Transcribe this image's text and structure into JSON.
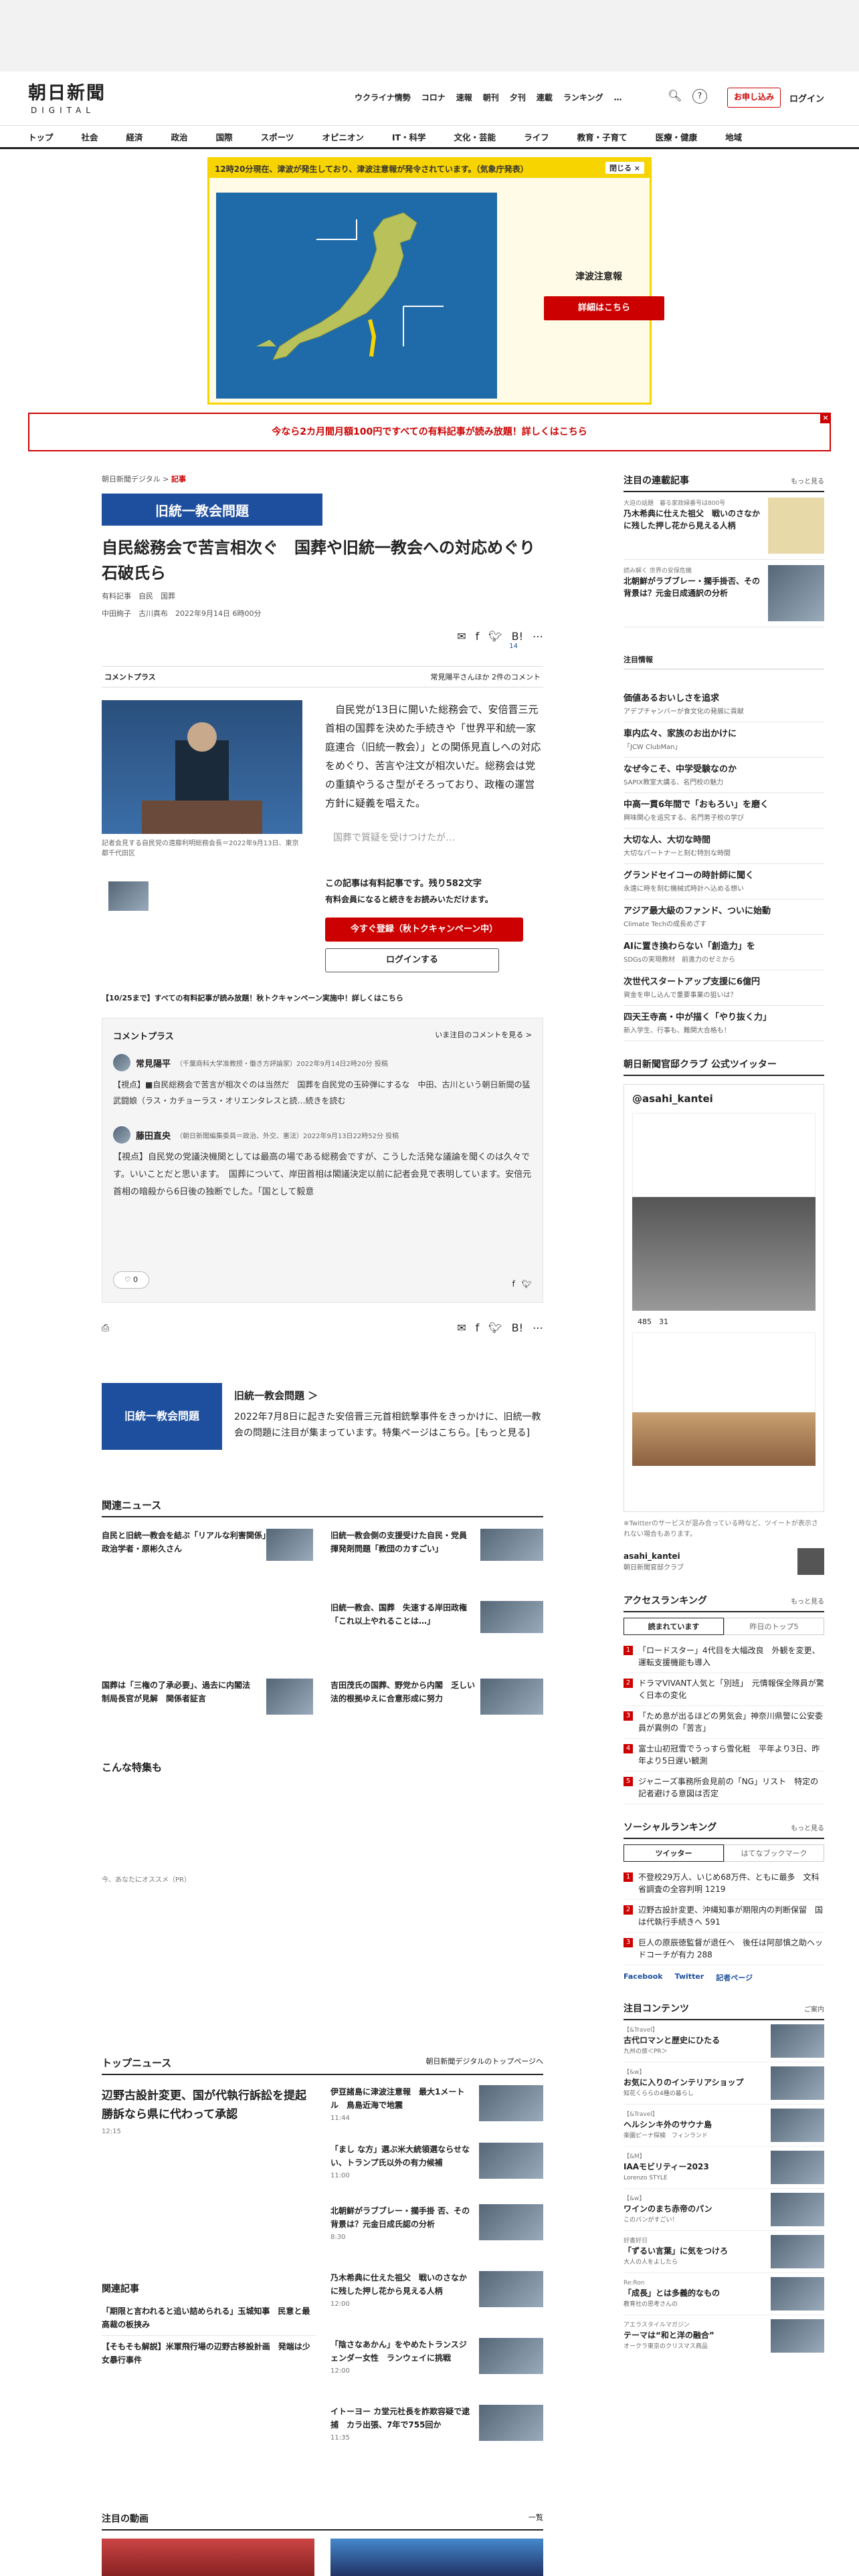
{
  "header": {
    "logo_ja": "朝日新聞",
    "logo_en": "DIGITAL",
    "nav": [
      "ウクライナ情勢",
      "コロナ",
      "速報",
      "朝刊",
      "夕刊",
      "連載",
      "ランキング",
      "…"
    ],
    "help": "?",
    "apply": "お申し込み",
    "login": "ログイン"
  },
  "categories": [
    "トップ",
    "社会",
    "経済",
    "政治",
    "国際",
    "スポーツ",
    "オピニオン",
    "IT・科学",
    "文化・芸能",
    "ライフ",
    "教育・子育て",
    "医療・健康",
    "地域"
  ],
  "tsunami": {
    "bar": "12時20分現在、津波が発生しており、津波注意報が発令されています。（気象庁発表）",
    "close": "閉じる ×",
    "label": "津波注意報",
    "button": "詳細はこちら"
  },
  "promo": {
    "text": "今なら2カ月間月額100円ですべての有料記事が読み放題！詳しくはこちら",
    "close": "×"
  },
  "article": {
    "breadcrumb_site": "朝日新聞デジタル",
    "breadcrumb_sep": ">",
    "breadcrumb_cat": "記事",
    "banner": "旧統一教会問題",
    "title": "自民総務会で苦言相次ぐ　国葬や旧統一教会への対応めぐり石破氏ら",
    "tags": "有料記事　自民　国葬",
    "authors": "中田絢子　古川真布　2022年9月14日 6時00分",
    "share_count": "14",
    "comment_plus": "コメントプラス",
    "comment_note": "常見陽平さんほか 2件のコメント",
    "photo_caption": "記者会見する自民党の遠藤利明総務会長＝2022年9月13日、東京都千代田区",
    "body": "　自民党が13日に開いた総務会で、安倍晋三元首相の国葬を決めた手続きや「世界平和統一家庭連合（旧統一教会）」との関係見直しへの対応をめぐり、苦言や注文が相次いだ。総務会は党の重鎮やうるさ型がそろっており、政権の運営方針に疑義を唱えた。",
    "body_cut": "国葬で質疑を受けつけたが…",
    "paywall": "この記事は有料記事です。残り582文字",
    "paywall2": "有料会員になると続きをお読みいただけます。",
    "subscribe": "今すぐ登録（秋トクキャンペーン中）",
    "login": "ログインする",
    "campaign": "【10/25まで】すべての有料記事が読み放題！秋トクキャンペーン実施中！詳しくはこちら"
  },
  "comments": {
    "title": "コメントプラス",
    "link": "いま注目のコメントを見る >",
    "items": [
      {
        "name": "常見陽平",
        "role": "（千葉商科大学准教授・働き方評論家）2022年9月14日2時20分 投稿",
        "text": "【視点】■自民総務会で苦言が相次ぐのは当然だ　国葬を自民党の玉砕弾にするな　中田、古川という朝日新聞の猛武闘娘（ラス・カチョーラス・オリエンタレスと読…続きを読む"
      },
      {
        "name": "藤田直央",
        "role": "（朝日新聞編集委員＝政治、外交、憲法）2022年9月13日22時52分 投稿",
        "text": "【視点】自民党の党議決機関としては最高の場である総務会ですが、こうした活発な議論を聞くのは久々です。いいことだと思います。　国葬について、岸田首相は閣議決定以前に記者会見で表明しています。安倍元首相の暗殺から6日後の独断でした。「国として毅意"
      }
    ],
    "likes": "0"
  },
  "feature": {
    "title": "旧統一教会問題 ＞",
    "text": "2022年7月8日に起きた安倍晋三元首相銃撃事件をきっかけに、旧統一教会の問題に注目が集まっています。特集ページはこちら。[もっと見る]"
  },
  "related": {
    "title": "関連ニュース",
    "items": [
      "自民と旧統一教会を結ぶ「リアルな利害関係」　政治学者・原彬久さん",
      "旧統一教会側の支援受けた自民・党員　揮発剤問題「教団のカすごい」",
      "旧統一教会、国葬　失速する岸田政権　「これ以上やれることは…」",
      "国葬は「三権の了承必要」、過去に内閣法制局長官が見解　関係者証言",
      "吉田茂氏の国葬、野党から内閣　乏しい法的根拠ゆえに合意形成に努力"
    ]
  },
  "specials_title": "こんな特集も",
  "recommend_title": "今、あなたにオススメ（PR）",
  "topnews": {
    "title": "トップニュース",
    "link": "朝日新聞デジタルのトップページへ",
    "main": "辺野古設計変更、国が代執行訴訟を提起　勝訴なら県に代わって承認",
    "main_time": "12:15",
    "items": [
      {
        "t": "伊豆諸島に津波注意報　最大1メートル　鳥島近海で地震",
        "time": "11:44"
      },
      {
        "t": "「まし な方」選ぶ米大統領選ならせない、トランプ氏以外の有力候補",
        "time": "11:00"
      },
      {
        "t": "北朝鮮がラブブレー・擱手掛 否、その背景は？元金日成氏認の分析",
        "time": "8:30"
      },
      {
        "t": "乃木希典に仕えた祖父　戦いのさなかに残した押し花から見える人柄",
        "time": "12:00"
      },
      {
        "t": "「陰さなあかん」をやめたトランスジェンダー女性　ランウェイに挑戦",
        "time": "12:00"
      },
      {
        "t": "イトーヨー カ堂元社長を詐欺容疑で逮捕　カラ出張、7年で755回か",
        "time": "11:35"
      }
    ],
    "related_title": "関連記事",
    "related": [
      "「期限と言われると追い詰められる」玉城知事　民意と最高裁の板挟み",
      "【そもそも解説】米軍飛行場の辺野古移設計画　発端は少女暴行事件"
    ]
  },
  "video_title": "注目の動画",
  "video_more": "一覧",
  "sidebar": {
    "series_title": "注目の連載記事",
    "more": "もっと見る",
    "series": [
      {
        "t": "乃木希典に仕えた祖父　戦いのさなかに残した押し花から見える人柄",
        "s": "大迫の話題　暮る家政婦番号は800号"
      },
      {
        "t": "北朝鮮がラブブレー・擱手掛否、その背景は？元金日成通訳の分析",
        "s": "読み解く 世界の安保危機"
      }
    ],
    "pr_title": "注目情報",
    "pr": [
      {
        "t": "価値あるおいしさを追求",
        "s": "アデプチャンバーが食文化の発展に貢献"
      },
      {
        "t": "車内広々、家族のお出かけに",
        "s": "「JCW ClubMan」"
      },
      {
        "t": "なぜ今こそ、中学受験なのか",
        "s": "SAPIX教室大講る、名門校の魅力"
      },
      {
        "t": "中高一貫6年間で「おもろい」を磨く",
        "s": "興味関心を追究する、名門男子校の学び"
      },
      {
        "t": "大切な人、大切な時間",
        "s": "大切なパートナーと刻む特別な時間"
      },
      {
        "t": "グランドセイコーの時計師に聞く",
        "s": "永遠に時を刻む機械式時計へ込める想い"
      },
      {
        "t": "アジア最大級のファンド、ついに始動",
        "s": "Climate Techの成長めざす"
      },
      {
        "t": "AIに置き換わらない「創造力」を",
        "s": "SDGsの実現教材　前進力のゼミから"
      },
      {
        "t": "次世代スタートアップ支援に6億円",
        "s": "資金を申し込んで重要事業の狙いは？"
      },
      {
        "t": "四天王寺高・中が描く「やり抜く力」",
        "s": "新入学生、行事も、難関大合格も！"
      }
    ],
    "twitter_title": "朝日新聞官邸クラブ 公式ツイッター",
    "twitter_handle": "@asahi_kantei",
    "tw_counts": "485　31",
    "tw_note": "※Twitterのサービスが混み合っている時など、ツイートが表示されない場合もあります。",
    "tw_account": "asahi_kantei",
    "tw_account_sub": "朝日新聞官邸クラブ",
    "ranking_title": "アクセスランキング",
    "ranking_tabs": [
      "読まれています",
      "昨日のトップ5"
    ],
    "ranking": [
      "「ロードスター」4代目を大幅改良　外観を変更、運転支援機能も導入",
      "ドラマVIVANT人気と「別班」　元情報保全隊員が驚く日本の変化",
      "「ため息が出るほどの男気会」神奈川県警に公安委員が異例の「苦言」",
      "富士山初冠雪でうっすら雪化粧　平年より3日、昨年より5日遅い観測",
      "ジャニーズ事務所会見前の「NG」リスト　特定の記者避ける意図は否定"
    ],
    "social_title": "ソーシャルランキング",
    "social_tabs": [
      "ツイッター",
      "はてなブックマーク"
    ],
    "social": [
      "不登校29万人、いじめ68万件、ともに最多　文科省調査の全容判明 1219",
      "辺野古設計変更、沖縄知事が期限内の判断保留　国は代執行手続きへ 591",
      "巨人の原辰徳監督が退任へ　後任は阿部慎之助ヘッドコーチが有力 288"
    ],
    "follow": [
      "Facebook",
      "Twitter",
      "記者ページ"
    ],
    "contents_title": "注目コンテンツ",
    "contents_more": "ご案内",
    "contents": [
      {
        "tag": "【&Travel】",
        "t": "古代ロマンと歴史にひたる",
        "s": "九州の旅＜PR＞"
      },
      {
        "tag": "【&w】",
        "t": "お気に入りのインテリアショップ",
        "s": "知花くららの4種の暮らし"
      },
      {
        "tag": "【&Travel】",
        "t": "ヘルシンキ外のサウナ島",
        "s": "楽園ピーナ探検　フィンランド"
      },
      {
        "tag": "【&M】",
        "t": "IAAモビリティー2023",
        "s": "Lorenzo STYLE"
      },
      {
        "tag": "【&w】",
        "t": "ワインのまち赤帝のパン",
        "s": "このパンがすごい！"
      },
      {
        "tag": "好書好日",
        "t": "「ずるい言葉」に気をつけろ",
        "s": "大人の人をよしたら"
      },
      {
        "tag": "Re:Ron",
        "t": "「成長」とは多義的なもの",
        "s": "教育社の思考さんの"
      },
      {
        "tag": "アエラスタイルマガジン",
        "t": "テーマは“和と洋の融合”",
        "s": "オークラ東京のクリスマス商品"
      }
    ]
  },
  "colors": {
    "accent": "#cc0000",
    "banner": "#1d4f9e",
    "tsunami": "#f7d300"
  }
}
